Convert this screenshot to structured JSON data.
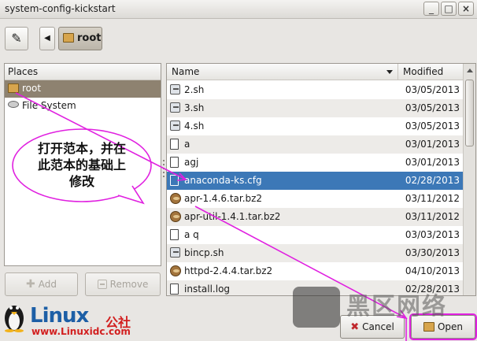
{
  "window": {
    "title": "system-config-kickstart",
    "minimize": "_",
    "maximize": "□",
    "close": "×"
  },
  "toolbar": {
    "breadcrumb_label": "root"
  },
  "places": {
    "header": "Places",
    "items": [
      {
        "label": "root",
        "icon": "home-folder-icon",
        "selected": true
      },
      {
        "label": "File System",
        "icon": "drive-icon",
        "selected": false
      }
    ],
    "add_label": "Add",
    "remove_label": "Remove"
  },
  "files": {
    "col_name": "Name",
    "col_modified": "Modified",
    "rows": [
      {
        "name": "2.sh",
        "modified": "03/05/2013",
        "icon": "script-icon"
      },
      {
        "name": "3.sh",
        "modified": "03/05/2013",
        "icon": "script-icon"
      },
      {
        "name": "4.sh",
        "modified": "03/05/2013",
        "icon": "script-icon"
      },
      {
        "name": "a",
        "modified": "03/01/2013",
        "icon": "document-icon"
      },
      {
        "name": "agj",
        "modified": "03/01/2013",
        "icon": "document-icon"
      },
      {
        "name": "anaconda-ks.cfg",
        "modified": "02/28/2013",
        "icon": "document-icon",
        "selected": true
      },
      {
        "name": "apr-1.4.6.tar.bz2",
        "modified": "03/11/2012",
        "icon": "archive-icon"
      },
      {
        "name": "apr-util-1.4.1.tar.bz2",
        "modified": "03/11/2012",
        "icon": "archive-icon"
      },
      {
        "name": "a q",
        "modified": "03/03/2013",
        "icon": "document-icon"
      },
      {
        "name": "bincp.sh",
        "modified": "03/30/2013",
        "icon": "script-icon"
      },
      {
        "name": "httpd-2.4.4.tar.bz2",
        "modified": "04/10/2013",
        "icon": "archive-icon"
      },
      {
        "name": "install.log",
        "modified": "02/28/2013",
        "icon": "document-icon"
      }
    ]
  },
  "dialog": {
    "cancel_label": "Cancel",
    "open_label": "Open"
  },
  "annotation": {
    "lines": [
      "打开范本，并在",
      "此范本的基础上",
      "修改"
    ],
    "color": "#e020e0"
  },
  "watermark": {
    "logo": "Linux",
    "logo_cn": "公社",
    "url": "www.Linuxidc.com",
    "right_cn": "黑区网络"
  }
}
